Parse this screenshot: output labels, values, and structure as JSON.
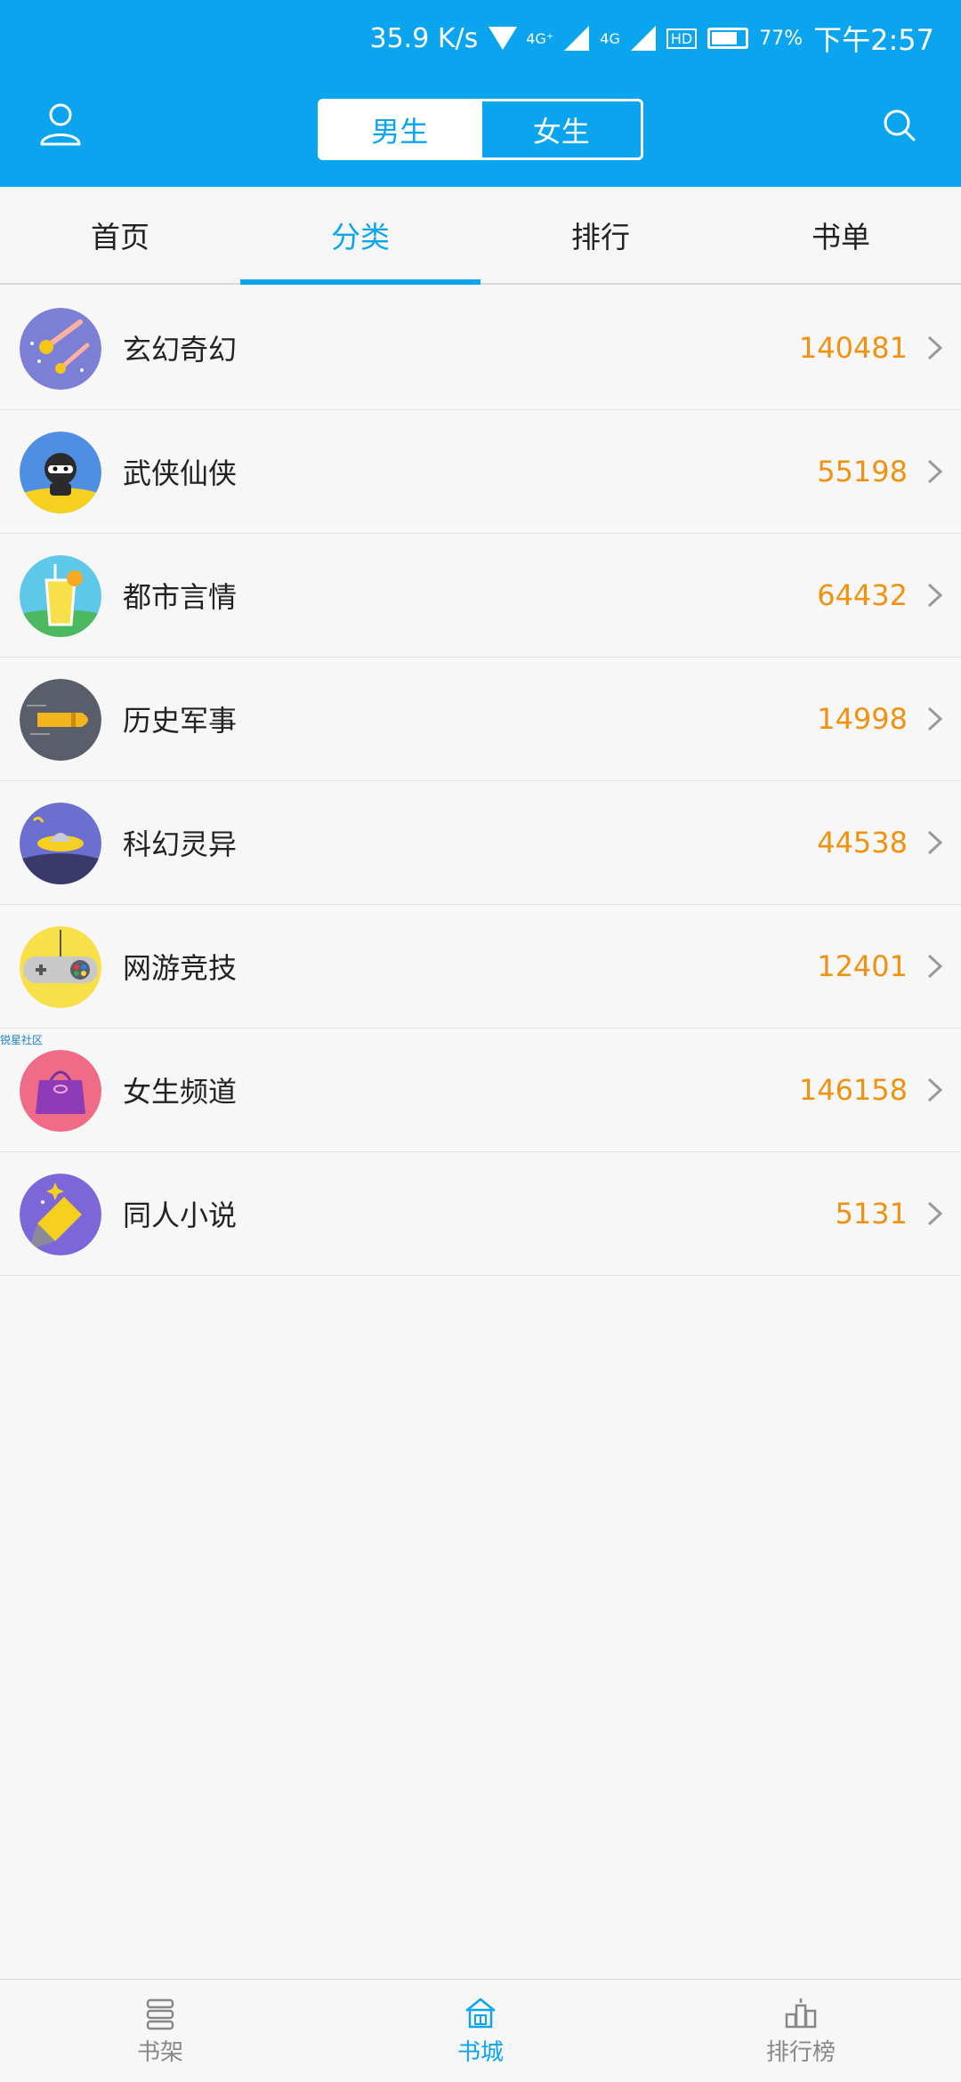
{
  "status_bar": {
    "speed": "35.9 K/s",
    "network_1": "4G⁺",
    "network_2": "4G",
    "hd": "HD",
    "battery": "77%",
    "time": "下午2:57"
  },
  "header": {
    "gender_tabs": [
      {
        "label": "男生",
        "active": true
      },
      {
        "label": "女生",
        "active": false
      }
    ]
  },
  "tabs": [
    {
      "label": "首页",
      "active": false
    },
    {
      "label": "分类",
      "active": true
    },
    {
      "label": "排行",
      "active": false
    },
    {
      "label": "书单",
      "active": false
    }
  ],
  "categories": [
    {
      "name": "玄幻奇幻",
      "count": "140481",
      "icon": "meteor-icon"
    },
    {
      "name": "武侠仙侠",
      "count": "55198",
      "icon": "ninja-icon"
    },
    {
      "name": "都市言情",
      "count": "64432",
      "icon": "juice-drink-icon"
    },
    {
      "name": "历史军事",
      "count": "14998",
      "icon": "bullet-icon"
    },
    {
      "name": "科幻灵异",
      "count": "44538",
      "icon": "ufo-icon"
    },
    {
      "name": "网游竞技",
      "count": "12401",
      "icon": "game-controller-icon"
    },
    {
      "name": "女生频道",
      "count": "146158",
      "icon": "handbag-icon"
    },
    {
      "name": "同人小说",
      "count": "5131",
      "icon": "magic-pencil-icon"
    }
  ],
  "watermark": "锐星社区",
  "bottom_nav": [
    {
      "label": "书架",
      "active": false,
      "icon": "bookshelf-icon"
    },
    {
      "label": "书城",
      "active": true,
      "icon": "bookstore-icon"
    },
    {
      "label": "排行榜",
      "active": false,
      "icon": "ranking-icon"
    }
  ],
  "colors": {
    "brand": "#0aa5ee",
    "count": "#f0920f"
  }
}
